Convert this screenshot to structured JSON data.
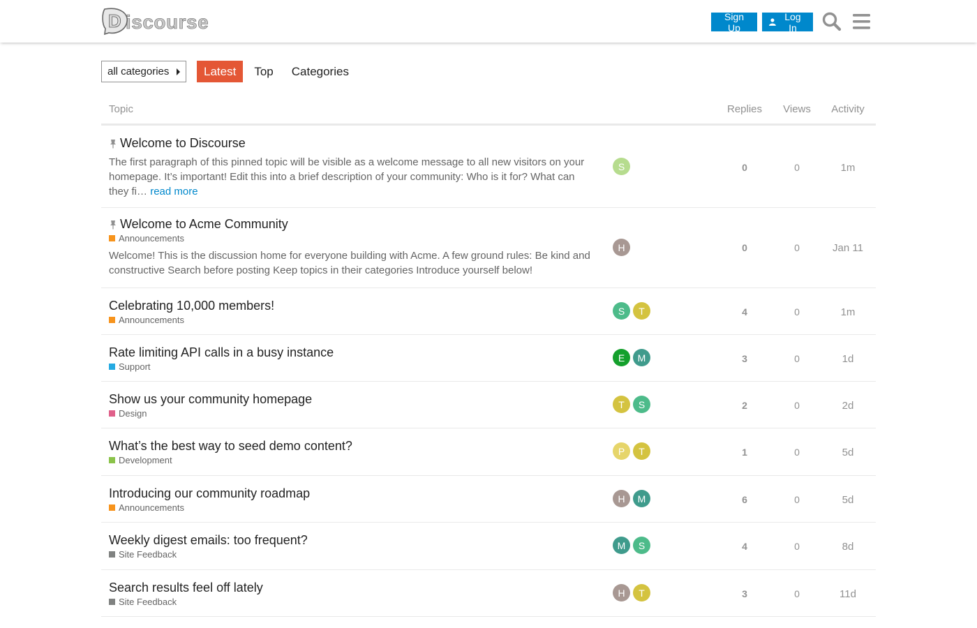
{
  "header": {
    "logo_text": "iscourse",
    "logo_letter": "D",
    "signup_label": "Sign Up",
    "login_label": "Log In",
    "icons": [
      "search-icon",
      "menu-icon",
      "user-icon"
    ]
  },
  "nav": {
    "category_dropdown": "all categories",
    "tabs": [
      {
        "label": "Latest",
        "active": true
      },
      {
        "label": "Top",
        "active": false
      },
      {
        "label": "Categories",
        "active": false
      }
    ],
    "accent_color": "#e45735"
  },
  "table": {
    "headers": {
      "topic": "Topic",
      "replies": "Replies",
      "views": "Views",
      "activity": "Activity"
    },
    "rows": [
      {
        "title": "Welcome to Discourse",
        "pinned": true,
        "category": "",
        "category_color": "",
        "excerpt": "The first paragraph of this pinned topic will be visible as a welcome message to all new visitors on your homepage. It’s important! Edit this into a brief description of your community: Who is it for? What can they fi…",
        "read_more": "read more",
        "posters": [
          {
            "letter": "S",
            "color": "#b6dc8e"
          }
        ],
        "replies": "0",
        "views": "0",
        "activity": "1m"
      },
      {
        "title": "Welcome to Acme Community",
        "pinned": true,
        "category": "Announcements",
        "category_color": "#f7941d",
        "excerpt": "Welcome! This is the discussion home for everyone building with Acme. A few ground rules: Be kind and constructive Search before posting Keep topics in their categories Introduce yourself below!",
        "read_more": "",
        "posters": [
          {
            "letter": "H",
            "color": "#a89893"
          }
        ],
        "replies": "0",
        "views": "0",
        "activity": "Jan 11"
      },
      {
        "title": "Celebrating 10,000 members!",
        "pinned": false,
        "category": "Announcements",
        "category_color": "#f7941d",
        "excerpt": "",
        "read_more": "",
        "posters": [
          {
            "letter": "S",
            "color": "#4dbb8a"
          },
          {
            "letter": "T",
            "color": "#d4c340"
          }
        ],
        "replies": "4",
        "views": "0",
        "activity": "1m"
      },
      {
        "title": "Rate limiting API calls in a busy instance",
        "pinned": false,
        "category": "Support",
        "category_color": "#25aae2",
        "excerpt": "",
        "read_more": "",
        "posters": [
          {
            "letter": "E",
            "color": "#14a02c"
          },
          {
            "letter": "M",
            "color": "#3f9b8c"
          }
        ],
        "replies": "3",
        "views": "0",
        "activity": "1d"
      },
      {
        "title": "Show us your community homepage",
        "pinned": false,
        "category": "Design",
        "category_color": "#e0608a",
        "excerpt": "",
        "read_more": "",
        "posters": [
          {
            "letter": "T",
            "color": "#d4c340"
          },
          {
            "letter": "S",
            "color": "#4dbb8a"
          }
        ],
        "replies": "2",
        "views": "0",
        "activity": "2d"
      },
      {
        "title": "What’s the best way to seed demo content?",
        "pinned": false,
        "category": "Development",
        "category_color": "#8bc34a",
        "excerpt": "",
        "read_more": "",
        "posters": [
          {
            "letter": "P",
            "color": "#e6d56a"
          },
          {
            "letter": "T",
            "color": "#d4c340"
          }
        ],
        "replies": "1",
        "views": "0",
        "activity": "5d"
      },
      {
        "title": "Introducing our community roadmap",
        "pinned": false,
        "category": "Announcements",
        "category_color": "#f7941d",
        "excerpt": "",
        "read_more": "",
        "posters": [
          {
            "letter": "H",
            "color": "#a89893"
          },
          {
            "letter": "M",
            "color": "#3f9b8c"
          }
        ],
        "replies": "6",
        "views": "0",
        "activity": "5d"
      },
      {
        "title": "Weekly digest emails: too frequent?",
        "pinned": false,
        "category": "Site Feedback",
        "category_color": "#808281",
        "excerpt": "",
        "read_more": "",
        "posters": [
          {
            "letter": "M",
            "color": "#3f9b8c"
          },
          {
            "letter": "S",
            "color": "#4dbb8a"
          }
        ],
        "replies": "4",
        "views": "0",
        "activity": "8d"
      },
      {
        "title": "Search results feel off lately",
        "pinned": false,
        "category": "Site Feedback",
        "category_color": "#808281",
        "excerpt": "",
        "read_more": "",
        "posters": [
          {
            "letter": "H",
            "color": "#a89893"
          },
          {
            "letter": "T",
            "color": "#d4c340"
          }
        ],
        "replies": "3",
        "views": "0",
        "activity": "11d"
      }
    ]
  }
}
